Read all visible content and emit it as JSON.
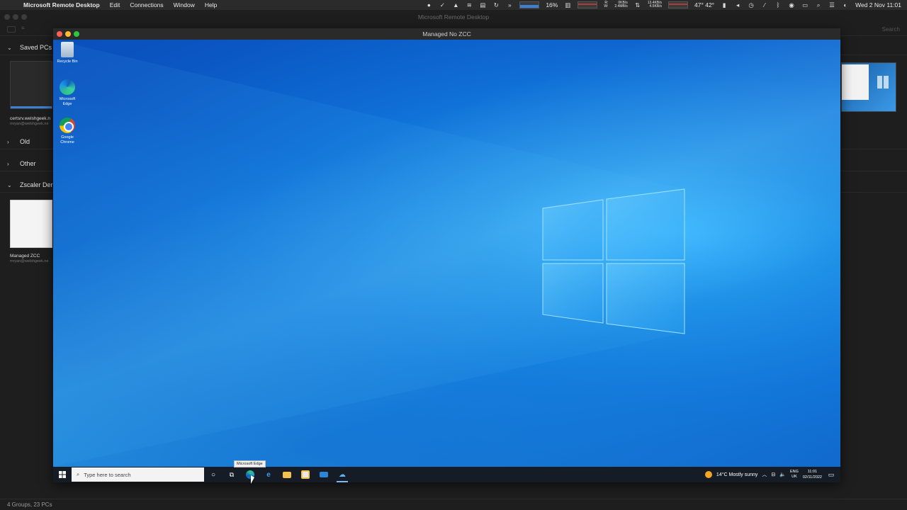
{
  "menubar": {
    "app_name": "Microsoft Remote Desktop",
    "menus": [
      "Edit",
      "Connections",
      "Window",
      "Help"
    ],
    "cpu_percent": "16%",
    "net_top": "0KB/s",
    "net_bottom": "2.4MB/s",
    "net_r": "R:",
    "net_w": "W:",
    "net2_top": "13.4KB/s",
    "net2_bottom": "4.5KB/s",
    "temps": "47° 42°",
    "datetime": "Wed 2 Nov  11:01"
  },
  "mrd": {
    "title": "Microsoft Remote Desktop",
    "search_placeholder": "Search",
    "groups": [
      {
        "label": "Saved PCs",
        "expanded": true
      },
      {
        "label": "Old",
        "expanded": false
      },
      {
        "label": "Other",
        "expanded": false
      },
      {
        "label": "Zscaler Der",
        "expanded": true
      }
    ],
    "pcs": [
      {
        "name": "certsrv.welshgeek.n",
        "user": "mryan@welshgeek.ne"
      },
      {
        "name": "Managed ZCC",
        "user": "mryan@welshgeek.ne"
      }
    ],
    "footer": "4 Groups, 23 PCs"
  },
  "session": {
    "title": "Managed No ZCC",
    "desktop_icons": [
      {
        "label": "Recycle Bin",
        "icon": "recycle-bin-icon"
      },
      {
        "label": "Microsoft Edge",
        "icon": "edge-icon"
      },
      {
        "label": "Google Chrome",
        "icon": "chrome-icon"
      }
    ],
    "taskbar": {
      "search_placeholder": "Type here to search",
      "tooltip": "Microsoft Edge",
      "weather": "14°C  Mostly sunny",
      "lang_top": "ENG",
      "lang_bottom": "UK",
      "time": "11:01",
      "date": "02/11/2022"
    }
  },
  "colors": {
    "accent": "#0a6fd6",
    "taskbar": "#161c26",
    "close": "#ff5f57",
    "minimize": "#febc2e",
    "maximize": "#28c840"
  }
}
